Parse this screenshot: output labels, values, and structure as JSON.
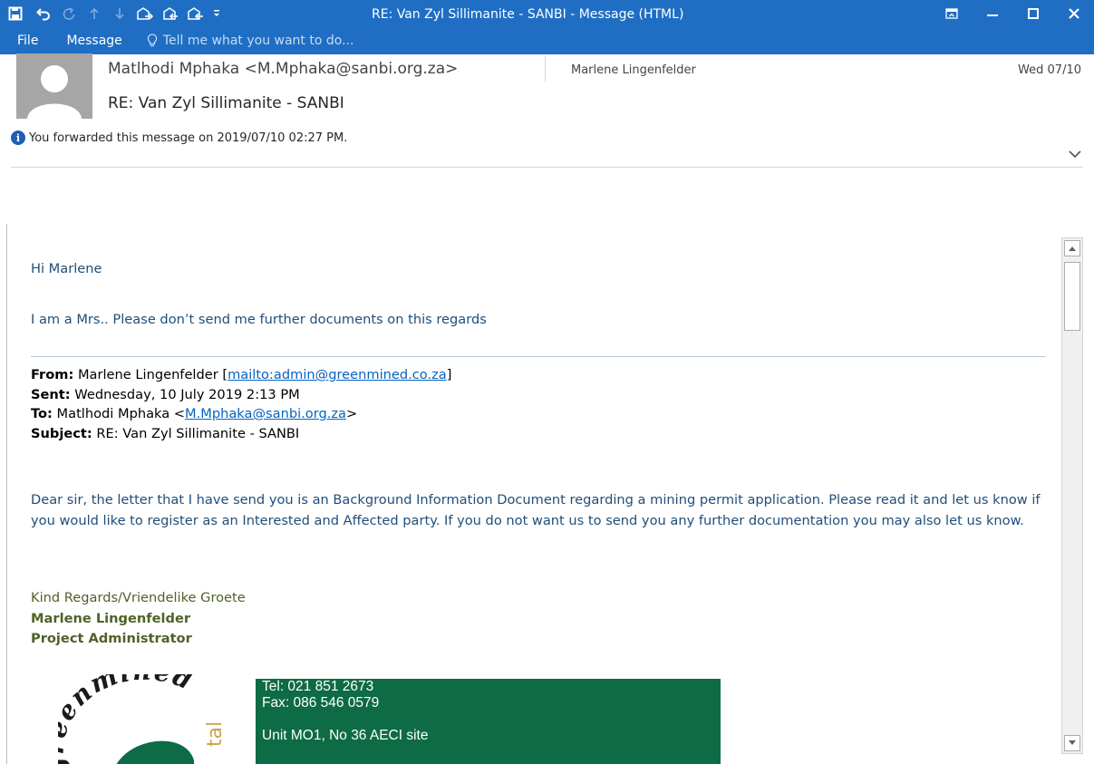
{
  "window": {
    "title": "RE: Van Zyl Sillimanite - SANBI - Message (HTML)",
    "accent": "#1f6ec4",
    "quick_access": [
      "save-icon",
      "undo-icon",
      "redo-icon",
      "previous-item-icon",
      "next-item-icon",
      "reply-icon",
      "reply-all-icon",
      "forward-icon",
      "customize-dropdown-icon"
    ],
    "controls": [
      "ribbon-display-icon",
      "minimize-icon",
      "maximize-icon",
      "close-icon"
    ]
  },
  "ribbon": {
    "tabs": [
      "File",
      "Message"
    ],
    "tell_me": "Tell me what you want to do..."
  },
  "header": {
    "from": "Matlhodi Mphaka <M.Mphaka@sanbi.org.za>",
    "to": "Marlene Lingenfelder",
    "date": "Wed 07/10",
    "subject": "RE: Van Zyl Sillimanite - SANBI",
    "info": "You forwarded this message on 2019/07/10 02:27 PM."
  },
  "body": {
    "greeting": "Hi Marlene",
    "reply": "I am a Mrs.. Please don’t send me further documents on this regards",
    "forwarded": {
      "from_label": "From:",
      "from_name": " Marlene Lingenfelder [",
      "from_link": "mailto:admin@greenmined.co.za",
      "from_end": "]",
      "sent_label": "Sent:",
      "sent_value": " Wednesday, 10 July 2019 2:13 PM",
      "to_label": "To:",
      "to_name": " Matlhodi Mphaka <",
      "to_link": "M.Mphaka@sanbi.org.za",
      "to_end": ">",
      "subject_label": "Subject:",
      "subject_value": " RE: Van Zyl Sillimanite - SANBI"
    },
    "paragraph": "Dear sir, the letter that I have send you is an Background Information Document regarding a mining permit application. Please read it and let us know if you would like to register as an Interested and Affected party. If you do not want us to send you any further documentation you may also let us know.",
    "signature": {
      "closing": "Kind Regards/Vriendelike Groete",
      "name": "Marlene Lingenfelder",
      "role": "Project Administrator"
    },
    "logo_text": {
      "arc": "greenmined",
      "side": "tal"
    },
    "contact": {
      "tel": "Tel: 021 851 2673",
      "fax": "Fax: 086 546 0579",
      "address": "Unit MO1, No 36 AECI site"
    }
  }
}
